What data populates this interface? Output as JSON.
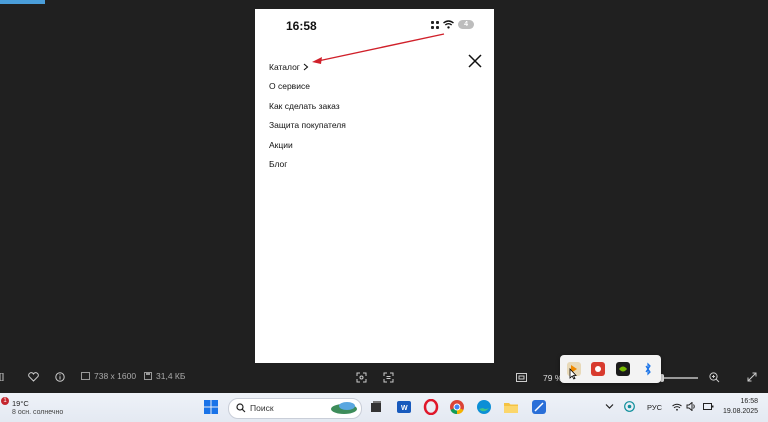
{
  "phone": {
    "time": "16:58",
    "battery": "4",
    "menu": [
      "Каталог",
      "О сервисе",
      "Как сделать заказ",
      "Защита покупателя",
      "Акции",
      "Блог"
    ]
  },
  "viewer": {
    "dimensions": "738 x 1600",
    "size": "31,4 КБ",
    "zoom": "79 %"
  },
  "taskbar": {
    "weather_badge": "1",
    "temperature": "19°C",
    "condition": "8 осн. солнечно",
    "search_placeholder": "Поиск",
    "language": "РУС",
    "time": "16:58",
    "date": "19.08.2025"
  },
  "colors": {
    "accent": "#4a9eda",
    "annotation": "#d0202a"
  }
}
